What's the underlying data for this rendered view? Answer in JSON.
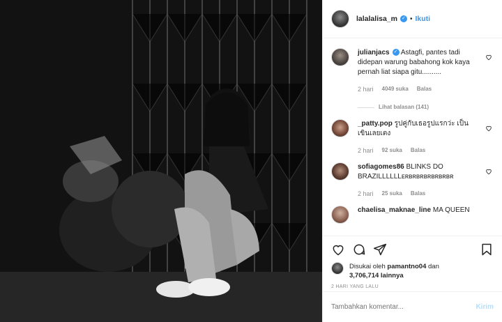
{
  "header": {
    "username": "lalalalisa_m",
    "separator": "•",
    "follow_label": "Ikuti"
  },
  "comments": [
    {
      "username": "julianjacs",
      "verified": true,
      "text": "Astagfi, pantes tadi didepan warung babahong kok kaya pernah liat siapa gitu..........",
      "time": "2 hari",
      "likes": "4049 suka",
      "reply_label": "Balas",
      "view_replies": "Lihat balasan (141)"
    },
    {
      "username": "_patty.pop",
      "text": "รูปคู่กับเธอรูปแรกว่ะ เป็นเขินเลยเตง",
      "time": "2 hari",
      "likes": "92 suka",
      "reply_label": "Balas"
    },
    {
      "username": "sofiagomes86",
      "text": "BLINKS DO BRAZILLLLLLᴇʀʙʀʙʀʙʀʙʀʙʀʙʀ",
      "time": "2 hari",
      "likes": "25 suka",
      "reply_label": "Balas"
    },
    {
      "username": "chaelisa_maknae_line",
      "text": "MA QUEEN"
    }
  ],
  "likes": {
    "prefix": "Disukai oleh",
    "user": "pamantno04",
    "joiner": "dan",
    "count": "3,706,714 lainnya"
  },
  "date": "2 HARI YANG LALU",
  "add_comment": {
    "placeholder": "Tambahkan komentar...",
    "post_label": "Kirim"
  },
  "colors": {
    "accent": "#3897f0",
    "muted": "#8e8e8e",
    "post_disabled": "#b2dffc"
  },
  "icons": [
    "heart-icon",
    "comment-icon",
    "share-icon",
    "bookmark-icon",
    "verified-icon"
  ]
}
